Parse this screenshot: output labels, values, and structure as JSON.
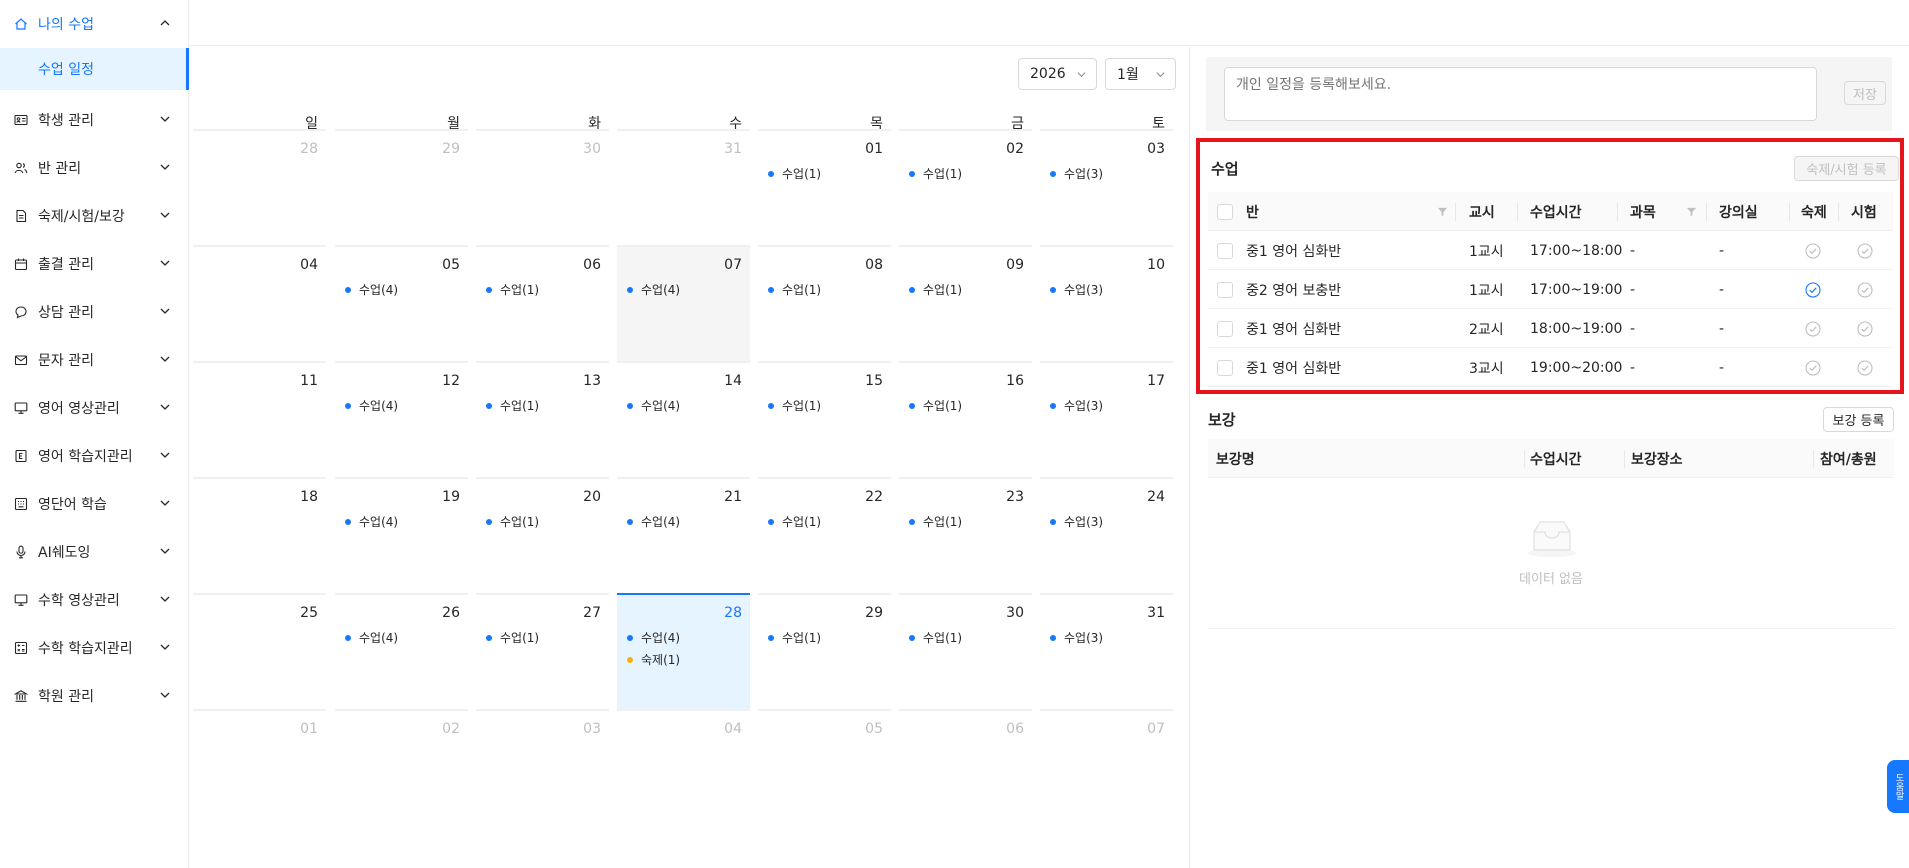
{
  "sidebar": {
    "items": [
      {
        "label": "나의 수업",
        "icon": "home-icon",
        "expanded": true
      },
      {
        "label": "학생 관리",
        "icon": "id-card-icon"
      },
      {
        "label": "반 관리",
        "icon": "users-icon"
      },
      {
        "label": "숙제/시험/보강",
        "icon": "document-icon"
      },
      {
        "label": "출결 관리",
        "icon": "calendar-icon"
      },
      {
        "label": "상담 관리",
        "icon": "chat-icon"
      },
      {
        "label": "문자 관리",
        "icon": "mail-icon"
      },
      {
        "label": "영어 영상관리",
        "icon": "monitor-icon"
      },
      {
        "label": "영어 학습지관리",
        "icon": "letter-e-icon"
      },
      {
        "label": "영단어 학습",
        "icon": "keyboard-icon"
      },
      {
        "label": "AI쉐도잉",
        "icon": "microphone-icon"
      },
      {
        "label": "수학 영상관리",
        "icon": "monitor-icon"
      },
      {
        "label": "수학 학습지관리",
        "icon": "calculator-icon"
      },
      {
        "label": "학원 관리",
        "icon": "bank-icon"
      }
    ],
    "sub_item": "수업 일정"
  },
  "calendar": {
    "year": "2026",
    "month": "1월",
    "weekdays": [
      "일",
      "월",
      "화",
      "수",
      "목",
      "금",
      "토"
    ],
    "weeks": [
      [
        {
          "d": "28",
          "other": true,
          "events": []
        },
        {
          "d": "29",
          "other": true,
          "events": []
        },
        {
          "d": "30",
          "other": true,
          "events": []
        },
        {
          "d": "31",
          "other": true,
          "events": []
        },
        {
          "d": "01",
          "events": [
            {
              "label": "수업(1)",
              "type": "class"
            }
          ]
        },
        {
          "d": "02",
          "events": [
            {
              "label": "수업(1)",
              "type": "class"
            }
          ]
        },
        {
          "d": "03",
          "events": [
            {
              "label": "수업(3)",
              "type": "class"
            }
          ]
        }
      ],
      [
        {
          "d": "04",
          "events": []
        },
        {
          "d": "05",
          "events": [
            {
              "label": "수업(4)",
              "type": "class"
            }
          ]
        },
        {
          "d": "06",
          "events": [
            {
              "label": "수업(1)",
              "type": "class"
            }
          ]
        },
        {
          "d": "07",
          "selected": true,
          "events": [
            {
              "label": "수업(4)",
              "type": "class"
            }
          ]
        },
        {
          "d": "08",
          "events": [
            {
              "label": "수업(1)",
              "type": "class"
            }
          ]
        },
        {
          "d": "09",
          "events": [
            {
              "label": "수업(1)",
              "type": "class"
            }
          ]
        },
        {
          "d": "10",
          "events": [
            {
              "label": "수업(3)",
              "type": "class"
            }
          ]
        }
      ],
      [
        {
          "d": "11",
          "events": []
        },
        {
          "d": "12",
          "events": [
            {
              "label": "수업(4)",
              "type": "class"
            }
          ]
        },
        {
          "d": "13",
          "events": [
            {
              "label": "수업(1)",
              "type": "class"
            }
          ]
        },
        {
          "d": "14",
          "events": [
            {
              "label": "수업(4)",
              "type": "class"
            }
          ]
        },
        {
          "d": "15",
          "events": [
            {
              "label": "수업(1)",
              "type": "class"
            }
          ]
        },
        {
          "d": "16",
          "events": [
            {
              "label": "수업(1)",
              "type": "class"
            }
          ]
        },
        {
          "d": "17",
          "events": [
            {
              "label": "수업(3)",
              "type": "class"
            }
          ]
        }
      ],
      [
        {
          "d": "18",
          "events": []
        },
        {
          "d": "19",
          "events": [
            {
              "label": "수업(4)",
              "type": "class"
            }
          ]
        },
        {
          "d": "20",
          "events": [
            {
              "label": "수업(1)",
              "type": "class"
            }
          ]
        },
        {
          "d": "21",
          "events": [
            {
              "label": "수업(4)",
              "type": "class"
            }
          ]
        },
        {
          "d": "22",
          "events": [
            {
              "label": "수업(1)",
              "type": "class"
            }
          ]
        },
        {
          "d": "23",
          "events": [
            {
              "label": "수업(1)",
              "type": "class"
            }
          ]
        },
        {
          "d": "24",
          "events": [
            {
              "label": "수업(3)",
              "type": "class"
            }
          ]
        }
      ],
      [
        {
          "d": "25",
          "events": []
        },
        {
          "d": "26",
          "events": [
            {
              "label": "수업(4)",
              "type": "class"
            }
          ]
        },
        {
          "d": "27",
          "events": [
            {
              "label": "수업(1)",
              "type": "class"
            }
          ]
        },
        {
          "d": "28",
          "today": true,
          "events": [
            {
              "label": "수업(4)",
              "type": "class"
            },
            {
              "label": "숙제(1)",
              "type": "homework"
            }
          ]
        },
        {
          "d": "29",
          "events": [
            {
              "label": "수업(1)",
              "type": "class"
            }
          ]
        },
        {
          "d": "30",
          "events": [
            {
              "label": "수업(1)",
              "type": "class"
            }
          ]
        },
        {
          "d": "31",
          "events": [
            {
              "label": "수업(3)",
              "type": "class"
            }
          ]
        }
      ],
      [
        {
          "d": "01",
          "other": true,
          "events": []
        },
        {
          "d": "02",
          "other": true,
          "events": []
        },
        {
          "d": "03",
          "other": true,
          "events": []
        },
        {
          "d": "04",
          "other": true,
          "events": []
        },
        {
          "d": "05",
          "other": true,
          "events": []
        },
        {
          "d": "06",
          "other": true,
          "events": []
        },
        {
          "d": "07",
          "other": true,
          "events": []
        }
      ]
    ]
  },
  "memo": {
    "placeholder": "개인 일정을 등록해보세요.",
    "save_label": "저장"
  },
  "classes": {
    "title": "수업",
    "register_label": "숙제/시험 등록",
    "columns": {
      "class": "반",
      "period": "교시",
      "time": "수업시간",
      "subject": "과목",
      "room": "강의실",
      "homework": "숙제",
      "exam": "시험"
    },
    "rows": [
      {
        "class": "중1 영어 심화반",
        "period": "1교시",
        "time": "17:00~18:00",
        "subject": "-",
        "room": "-",
        "homework": false,
        "exam": false
      },
      {
        "class": "중2 영어 보충반",
        "period": "1교시",
        "time": "17:00~19:00",
        "subject": "-",
        "room": "-",
        "homework": true,
        "exam": false
      },
      {
        "class": "중1 영어 심화반",
        "period": "2교시",
        "time": "18:00~19:00",
        "subject": "-",
        "room": "-",
        "homework": false,
        "exam": false
      },
      {
        "class": "중1 영어 심화반",
        "period": "3교시",
        "time": "19:00~20:00",
        "subject": "-",
        "room": "-",
        "homework": false,
        "exam": false
      }
    ]
  },
  "makeup": {
    "title": "보강",
    "register_label": "보강 등록",
    "columns": {
      "name": "보강명",
      "time": "수업시간",
      "place": "보강장소",
      "attendance": "참여/총원"
    },
    "empty_text": "데이터 없음"
  },
  "help_tab": "도움말",
  "colors": {
    "accent": "#1677ff",
    "highlight_border": "#e5151b",
    "class_dot": "#1677ff",
    "homework_dot": "#faad14"
  }
}
